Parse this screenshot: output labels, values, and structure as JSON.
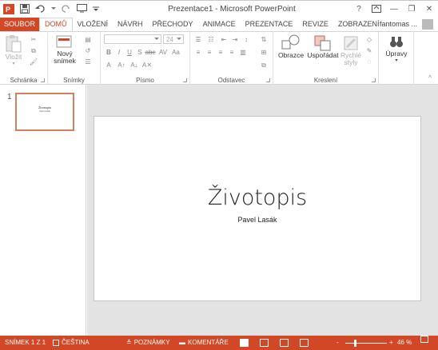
{
  "window": {
    "title": "Prezentace1 - Microsoft PowerPoint",
    "controls": {
      "help": "?",
      "minimize": "—",
      "restore": "❐",
      "close": "✕"
    }
  },
  "qat": {
    "save_icon": "save-icon",
    "undo_icon": "undo-icon",
    "redo_icon": "redo-icon",
    "present_icon": "start-from-beginning-icon",
    "customize": "customize-qat-icon"
  },
  "tabs": [
    {
      "label": "SOUBOR"
    },
    {
      "label": "DOMŮ"
    },
    {
      "label": "VLOŽENÍ"
    },
    {
      "label": "NÁVRH"
    },
    {
      "label": "PŘECHODY"
    },
    {
      "label": "ANIMACE"
    },
    {
      "label": "PREZENTACE"
    },
    {
      "label": "REVIZE"
    },
    {
      "label": "ZOBRAZENÍ"
    }
  ],
  "user": {
    "name": "fantomas ..."
  },
  "ribbon": {
    "clipboard": {
      "paste_label": "Vložit",
      "group_label": "Schránka"
    },
    "slides": {
      "new_slide_label_1": "Nový",
      "new_slide_label_2": "snímek",
      "group_label": "Snímky"
    },
    "font": {
      "font_size": "24",
      "group_label": "Písmo"
    },
    "paragraph": {
      "group_label": "Odstavec"
    },
    "drawing": {
      "shapes_label": "Obrazce",
      "arrange_label": "Uspořádat",
      "quick_styles_label_1": "Rychlé",
      "quick_styles_label_2": "styly",
      "group_label": "Kreslení"
    },
    "editing": {
      "label": "Úpravy"
    }
  },
  "thumbnails": [
    {
      "number": "1",
      "title": "Životopis",
      "subtitle": "Pavel Lasák"
    }
  ],
  "slide": {
    "title": "Životopis",
    "subtitle": "Pavel Lasák"
  },
  "status": {
    "slide_info": "SNÍMEK 1 Z 1",
    "language": "ČEŠTINA",
    "notes": "POZNÁMKY",
    "comments": "KOMENTÁŘE",
    "zoom_minus": "-",
    "zoom_plus": "+",
    "zoom": "46 %",
    "zoom_fraction": 0.46
  },
  "colors": {
    "accent": "#d24726",
    "thumb_border": "#d0805e"
  }
}
